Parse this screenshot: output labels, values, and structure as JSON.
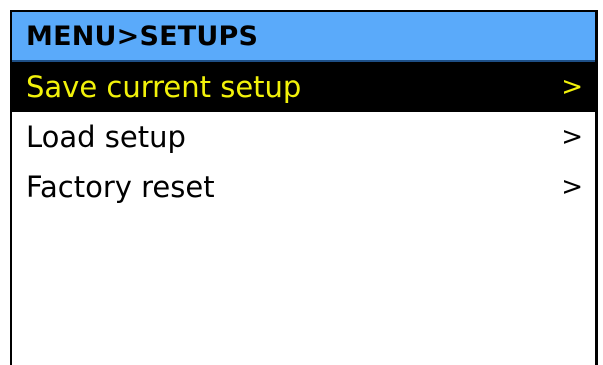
{
  "header": {
    "title": "MENU>SETUPS"
  },
  "menu": {
    "items": [
      {
        "label": "Save current setup",
        "arrow": ">",
        "selected": true
      },
      {
        "label": "Load setup",
        "arrow": ">",
        "selected": false
      },
      {
        "label": "Factory reset",
        "arrow": ">",
        "selected": false
      }
    ]
  },
  "colors": {
    "header_bg": "#5aaafa",
    "selected_bg": "#000000",
    "selected_text": "#f2f20a",
    "text": "#000000",
    "background": "#ffffff"
  }
}
